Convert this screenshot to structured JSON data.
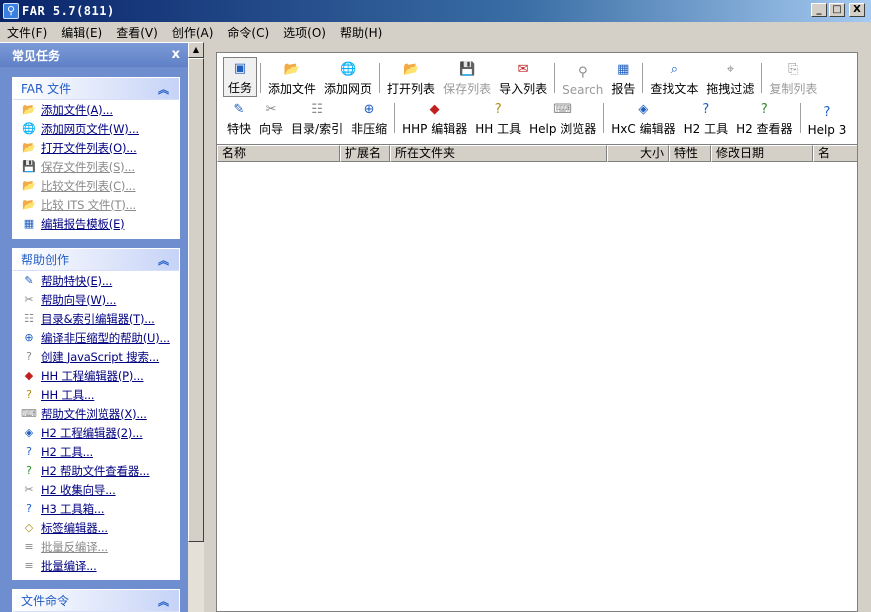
{
  "window": {
    "title": "FAR 5.7(811)",
    "buttons": {
      "minimize": "_",
      "maximize": "□",
      "close": "X"
    }
  },
  "menu": [
    "文件(F)",
    "编辑(E)",
    "查看(V)",
    "创作(A)",
    "命令(C)",
    "选项(O)",
    "帮助(H)"
  ],
  "left_pane": {
    "title": "常见任务",
    "close": "x",
    "groups": [
      {
        "title": "FAR 文件",
        "items": [
          {
            "label": "添加文件(A)...",
            "icon": "add-file-icon",
            "disabled": false
          },
          {
            "label": "添加网页文件(W)...",
            "icon": "add-web-file-icon",
            "disabled": false
          },
          {
            "label": "打开文件列表(O)...",
            "icon": "open-list-icon",
            "disabled": false
          },
          {
            "label": "保存文件列表(S)...",
            "icon": "save-icon",
            "disabled": true
          },
          {
            "label": "比较文件列表(C)...",
            "icon": "compare-icon",
            "disabled": true
          },
          {
            "label": "比较 ITS 文件(T)...",
            "icon": "compare-its-icon",
            "disabled": true
          },
          {
            "label": "编辑报告模板(E)",
            "icon": "report-template-icon",
            "disabled": false
          }
        ]
      },
      {
        "title": "帮助创作",
        "items": [
          {
            "label": "帮助特快(E)...",
            "icon": "help-express-icon",
            "disabled": false
          },
          {
            "label": "帮助向导(W)...",
            "icon": "wizard-icon",
            "disabled": false
          },
          {
            "label": "目录&索引编辑器(T)...",
            "icon": "toc-index-icon",
            "disabled": false
          },
          {
            "label": "编译非压缩型的帮助(U)...",
            "icon": "compile-icon",
            "disabled": false
          },
          {
            "label": "创建 JavaScript 搜索...",
            "icon": "javascript-icon",
            "disabled": false
          },
          {
            "label": "HH 工程编辑器(P)...",
            "icon": "hh-project-icon",
            "disabled": false
          },
          {
            "label": "HH 工具...",
            "icon": "hh-tools-icon",
            "disabled": false
          },
          {
            "label": "帮助文件浏览器(X)...",
            "icon": "help-browser-icon",
            "disabled": false
          },
          {
            "label": "H2 工程编辑器(2)...",
            "icon": "h2-project-icon",
            "disabled": false
          },
          {
            "label": "H2 工具...",
            "icon": "h2-tools-icon",
            "disabled": false
          },
          {
            "label": "H2 帮助文件查看器...",
            "icon": "h2-viewer-icon",
            "disabled": false
          },
          {
            "label": "H2 收集向导...",
            "icon": "h2-wizard-icon",
            "disabled": false
          },
          {
            "label": "H3 工具箱...",
            "icon": "h3-toolbox-icon",
            "disabled": false
          },
          {
            "label": "标签编辑器...",
            "icon": "tag-editor-icon",
            "disabled": false
          },
          {
            "label": "批量反编译...",
            "icon": "batch-decompile-icon",
            "disabled": true
          },
          {
            "label": "批量编译...",
            "icon": "batch-compile-icon",
            "disabled": false
          }
        ]
      },
      {
        "title": "文件命令",
        "items": []
      }
    ]
  },
  "toolbar": {
    "row1": [
      {
        "label": "任务",
        "icon": "tasks-icon",
        "active": true,
        "disabled": false
      },
      {
        "sep": true
      },
      {
        "label": "添加文件",
        "icon": "add-file-icon",
        "disabled": false
      },
      {
        "label": "添加网页",
        "icon": "add-web-icon",
        "disabled": false
      },
      {
        "sep": true
      },
      {
        "label": "打开列表",
        "icon": "open-list-icon",
        "disabled": false
      },
      {
        "label": "保存列表",
        "icon": "save-list-icon",
        "disabled": true
      },
      {
        "label": "导入列表",
        "icon": "import-list-icon",
        "disabled": false
      },
      {
        "sep": true
      },
      {
        "label": "Search",
        "icon": "search-icon",
        "disabled": true
      },
      {
        "label": "报告",
        "icon": "report-icon",
        "disabled": false
      },
      {
        "sep": true
      },
      {
        "label": "查找文本",
        "icon": "find-text-icon",
        "disabled": false
      },
      {
        "label": "拖拽过滤",
        "icon": "drag-filter-icon",
        "disabled": false
      },
      {
        "sep": true
      },
      {
        "label": "复制列表",
        "icon": "copy-list-icon",
        "disabled": true
      }
    ],
    "row2": [
      {
        "label": "特快",
        "icon": "express-icon",
        "disabled": false
      },
      {
        "label": "向导",
        "icon": "wizard-icon",
        "disabled": false
      },
      {
        "label": "目录/索引",
        "icon": "toc-index-icon",
        "disabled": false
      },
      {
        "label": "非压缩",
        "icon": "uncompressed-icon",
        "disabled": false
      },
      {
        "sep": true
      },
      {
        "label": "HHP 编辑器",
        "icon": "hhp-editor-icon",
        "disabled": false
      },
      {
        "label": "HH 工具",
        "icon": "hh-tools-icon",
        "disabled": false
      },
      {
        "label": "Help 浏览器",
        "icon": "help-browser-icon",
        "disabled": false
      },
      {
        "sep": true
      },
      {
        "label": "HxC 编辑器",
        "icon": "hxc-editor-icon",
        "disabled": false
      },
      {
        "label": "H2 工具",
        "icon": "h2-tools-icon",
        "disabled": false
      },
      {
        "label": "H2 查看器",
        "icon": "h2-viewer-icon",
        "disabled": false
      },
      {
        "sep": true
      },
      {
        "label": "Help 3",
        "icon": "help3-icon",
        "disabled": false
      }
    ]
  },
  "list": {
    "columns": [
      "名称",
      "扩展名",
      "所在文件夹",
      "大小",
      "特性",
      "修改日期",
      "名"
    ]
  }
}
